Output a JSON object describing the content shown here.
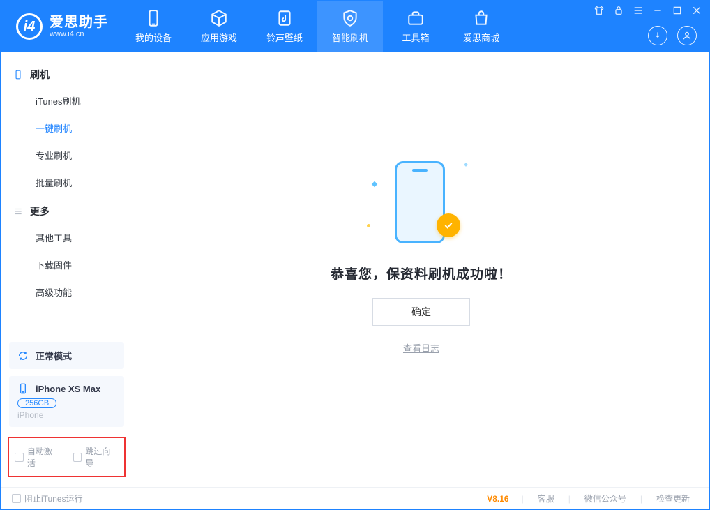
{
  "app": {
    "name": "爱思助手",
    "url": "www.i4.cn"
  },
  "tabs": [
    {
      "label": "我的设备"
    },
    {
      "label": "应用游戏"
    },
    {
      "label": "铃声壁纸"
    },
    {
      "label": "智能刷机"
    },
    {
      "label": "工具箱"
    },
    {
      "label": "爱思商城"
    }
  ],
  "sidebar": {
    "g1_title": "刷机",
    "g1_items": [
      "iTunes刷机",
      "一键刷机",
      "专业刷机",
      "批量刷机"
    ],
    "g1_active": 1,
    "g2_title": "更多",
    "g2_items": [
      "其他工具",
      "下载固件",
      "高级功能"
    ],
    "mode": "正常模式",
    "device_name": "iPhone XS Max",
    "device_cap": "256GB",
    "device_kind": "iPhone",
    "chk1": "自动激活",
    "chk2": "跳过向导"
  },
  "main": {
    "message": "恭喜您，保资料刷机成功啦！",
    "ok": "确定",
    "log": "查看日志"
  },
  "footer": {
    "itunes": "阻止iTunes运行",
    "version": "V8.16",
    "links": [
      "客服",
      "微信公众号",
      "检查更新"
    ]
  }
}
